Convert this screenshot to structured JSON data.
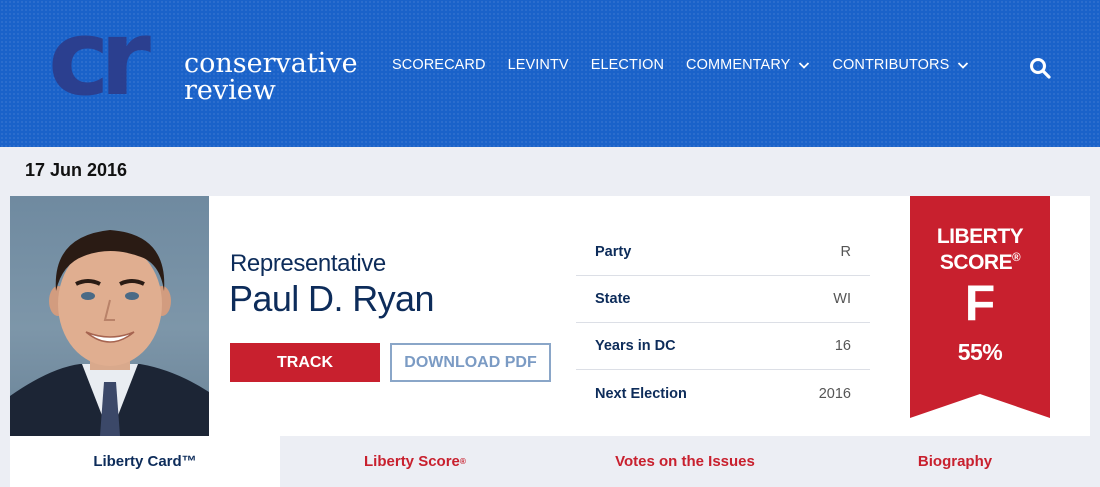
{
  "header": {
    "logo": {
      "mark": "cr",
      "line1": "conservative",
      "line2": "review"
    },
    "nav": [
      {
        "label": "SCORECARD",
        "dropdown": false
      },
      {
        "label": "LEVINTV",
        "dropdown": false
      },
      {
        "label": "ELECTION",
        "dropdown": false
      },
      {
        "label": "COMMENTARY",
        "dropdown": true
      },
      {
        "label": "CONTRIBUTORS",
        "dropdown": true
      }
    ],
    "search_icon": "search-icon"
  },
  "date": "17 Jun 2016",
  "profile": {
    "role": "Representative",
    "name": "Paul D. Ryan",
    "track_label": "TRACK",
    "pdf_label": "DOWNLOAD PDF",
    "info": [
      {
        "label": "Party",
        "value": "R"
      },
      {
        "label": "State",
        "value": "WI"
      },
      {
        "label": "Years in DC",
        "value": "16"
      },
      {
        "label": "Next Election",
        "value": "2016"
      }
    ],
    "score": {
      "line1": "LIBERTY",
      "line2": "SCORE",
      "mark": "®",
      "grade": "F",
      "percent": "55%"
    }
  },
  "tabs": [
    {
      "label": "Liberty Card™",
      "sup": "",
      "active": true
    },
    {
      "label": "Liberty Score",
      "sup": "®",
      "active": false
    },
    {
      "label": "Votes on the Issues",
      "sup": "",
      "active": false
    },
    {
      "label": "Biography",
      "sup": "",
      "active": false
    }
  ],
  "colors": {
    "header_blue": "#1a62c9",
    "logo_navy": "#2b3f8f",
    "text_navy": "#0d2c5a",
    "accent_red": "#c8202e",
    "pdf_blue": "#7b9bc4",
    "page_bg": "#eceef4"
  }
}
